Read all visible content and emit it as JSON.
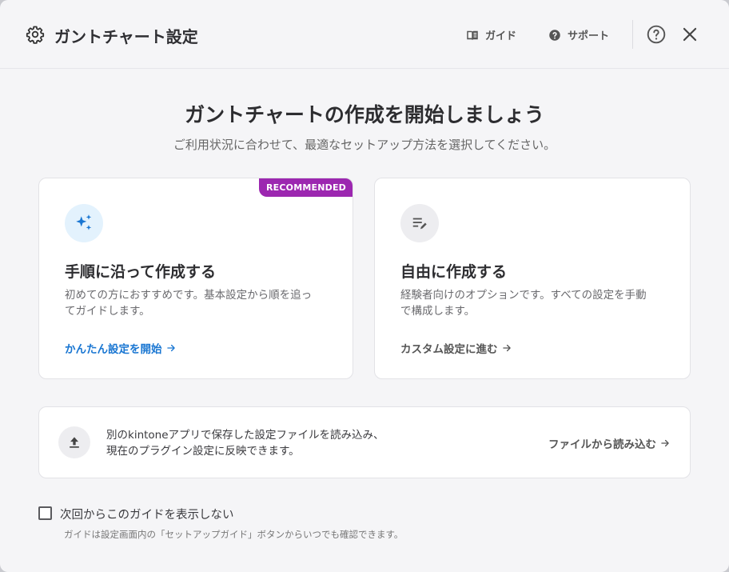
{
  "header": {
    "title": "ガントチャート設定",
    "guide_label": "ガイド",
    "support_label": "サポート",
    "icons": {
      "settings": "gear-icon",
      "guide": "book-icon",
      "support": "help-circle-icon",
      "help": "question-circle-icon",
      "close": "close-icon"
    }
  },
  "hero": {
    "title": "ガントチャートの作成を開始しましょう",
    "subtitle": "ご利用状況に合わせて、最適なセットアップ方法を選択してください。"
  },
  "cards": [
    {
      "badge": "RECOMMENDED",
      "icon": "sparkle-icon",
      "title": "手順に沿って作成する",
      "desc_line1": "初めての方におすすめです。基本設定から順を追っ",
      "desc_line2": "てガイドします。",
      "link": "かんたん設定を開始",
      "link_color": "#1976d2",
      "icon_bg": "#e3f2fd"
    },
    {
      "icon": "edit-list-icon",
      "title": "自由に作成する",
      "desc_line1": "経験者向けのオプションです。すべての設定を手動",
      "desc_line2": "で構成します。",
      "link": "カスタム設定に進む",
      "link_color": "#555555",
      "icon_bg": "#ededf0"
    }
  ],
  "import": {
    "icon": "upload-icon",
    "line1": "別のkintoneアプリで保存した設定ファイルを読み込み、",
    "line2": "現在のプラグイン設定に反映できます。",
    "link": "ファイルから読み込む"
  },
  "footer": {
    "checkbox_label": "次回からこのガイドを表示しない",
    "checked": false,
    "note": "ガイドは設定画面内の「セットアップガイド」ボタンからいつでも確認できます。"
  },
  "colors": {
    "accent_purple": "#9c27b0",
    "accent_blue": "#1976d2"
  }
}
